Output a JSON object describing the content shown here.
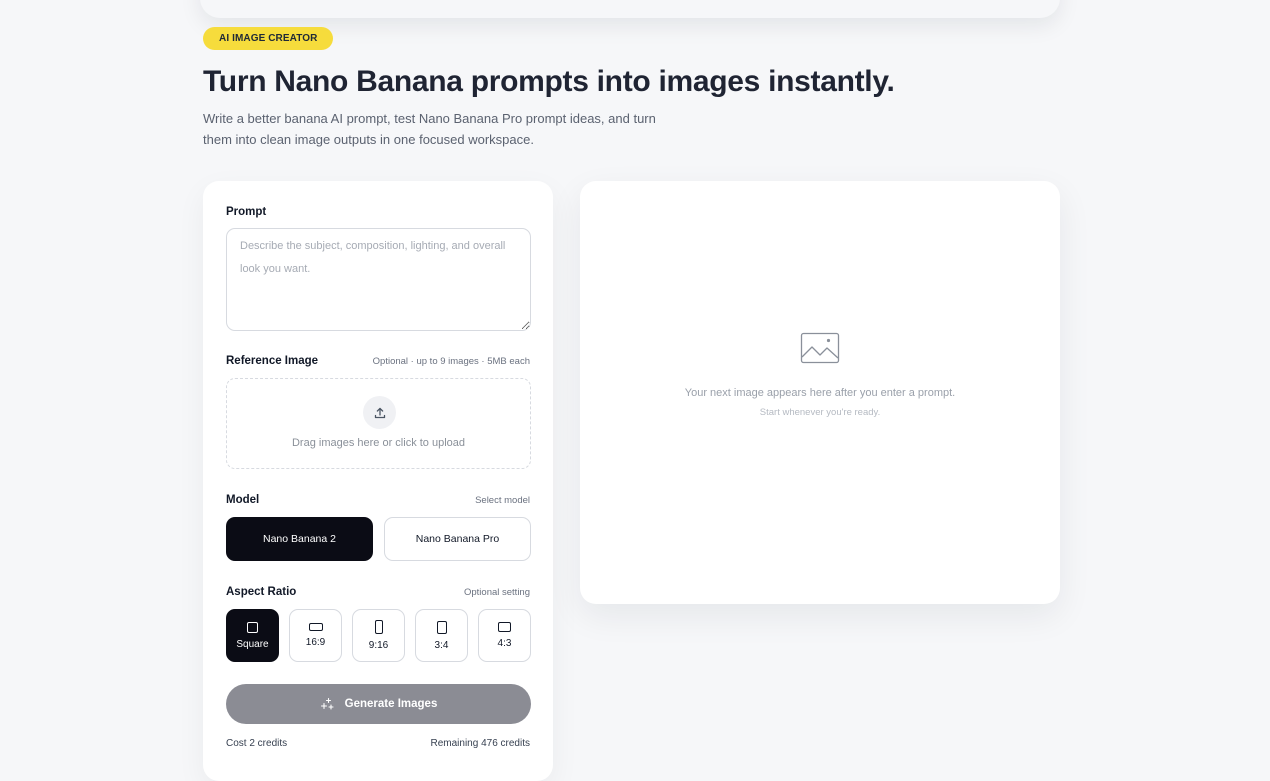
{
  "hero": {
    "badge": "AI IMAGE CREATOR",
    "title": "Turn Nano Banana prompts into images instantly.",
    "subtitle": "Write a better banana AI prompt, test Nano Banana Pro prompt ideas, and turn them into clean image outputs in one focused workspace."
  },
  "form": {
    "prompt_label": "Prompt",
    "prompt_placeholder": "Describe the subject, composition, lighting, and overall look you want.",
    "prompt_value": "",
    "reference_label": "Reference Image",
    "reference_hint": "Optional · up to 9 images · 5MB each",
    "upload_text": "Drag images here or click to upload",
    "model_label": "Model",
    "model_hint": "Select model",
    "models": [
      {
        "label": "Nano Banana 2",
        "selected": true
      },
      {
        "label": "Nano Banana Pro",
        "selected": false
      }
    ],
    "aspect_label": "Aspect Ratio",
    "aspect_hint": "Optional setting",
    "ratios": [
      {
        "label": "Square",
        "selected": true
      },
      {
        "label": "16:9",
        "selected": false
      },
      {
        "label": "9:16",
        "selected": false
      },
      {
        "label": "3:4",
        "selected": false
      },
      {
        "label": "4:3",
        "selected": false
      }
    ],
    "generate_label": "Generate Images",
    "cost_text": "Cost 2 credits",
    "remaining_text": "Remaining 476 credits"
  },
  "preview": {
    "empty_title": "Your next image appears here after you enter a prompt.",
    "empty_subtitle": "Start whenever you're ready."
  },
  "colors": {
    "badge": "#f6dc3c",
    "active": "#0b0c15",
    "button_disabled": "#8b8c94",
    "background": "#f6f7f9"
  },
  "icons": [
    "upload-icon",
    "sparkles-icon",
    "image-placeholder-icon"
  ]
}
